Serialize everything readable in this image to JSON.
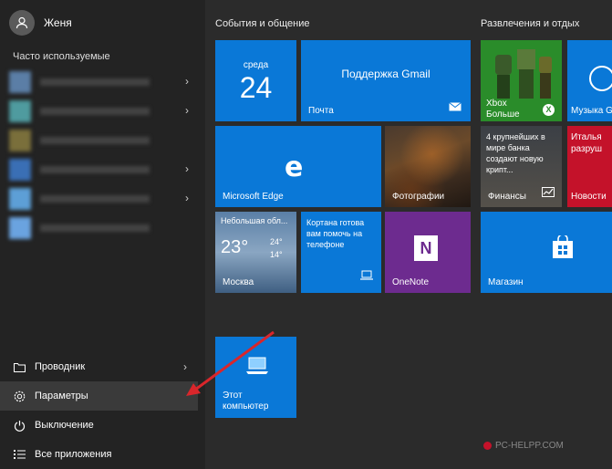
{
  "user": {
    "name": "Женя"
  },
  "frequent": {
    "label": "Часто используемые"
  },
  "bottom": {
    "explorer": "Проводник",
    "settings": "Параметры",
    "power": "Выключение",
    "all_apps": "Все приложения"
  },
  "groups": {
    "events": "События и общение",
    "entertainment": "Развлечения и отдых"
  },
  "tiles": {
    "calendar_day": "среда",
    "calendar_date": "24",
    "gmail_title": "Поддержка Gmail",
    "mail_label": "Почта",
    "edge_label": "Microsoft Edge",
    "photos_label": "Фотографии",
    "weather_cond": "Небольшая обл...",
    "weather_temp": "23°",
    "weather_hi": "24°",
    "weather_lo": "14°",
    "weather_city": "Москва",
    "cortana_text": "Кортана готова вам помочь на телефоне",
    "onenote_label": "OneNote",
    "xbox_label": "Xbox",
    "xbox_sub": "Больше",
    "music_label": "Музыка Gr",
    "finance_text": "4 крупнейших в мире банка создают новую крипт...",
    "finance_label": "Финансы",
    "news_text": "Италья разруш",
    "news_label": "Новости",
    "store_label": "Магазин",
    "pc_label": "Этот компьютер"
  },
  "watermark": "PC-HELPP.COM",
  "colors": {
    "tile_blue": "#0a78d7",
    "onenote_purple": "#6d2b8f",
    "xbox_green": "#2a8c2a",
    "news_red": "#c4122a",
    "arrow_red": "#d9262b"
  }
}
